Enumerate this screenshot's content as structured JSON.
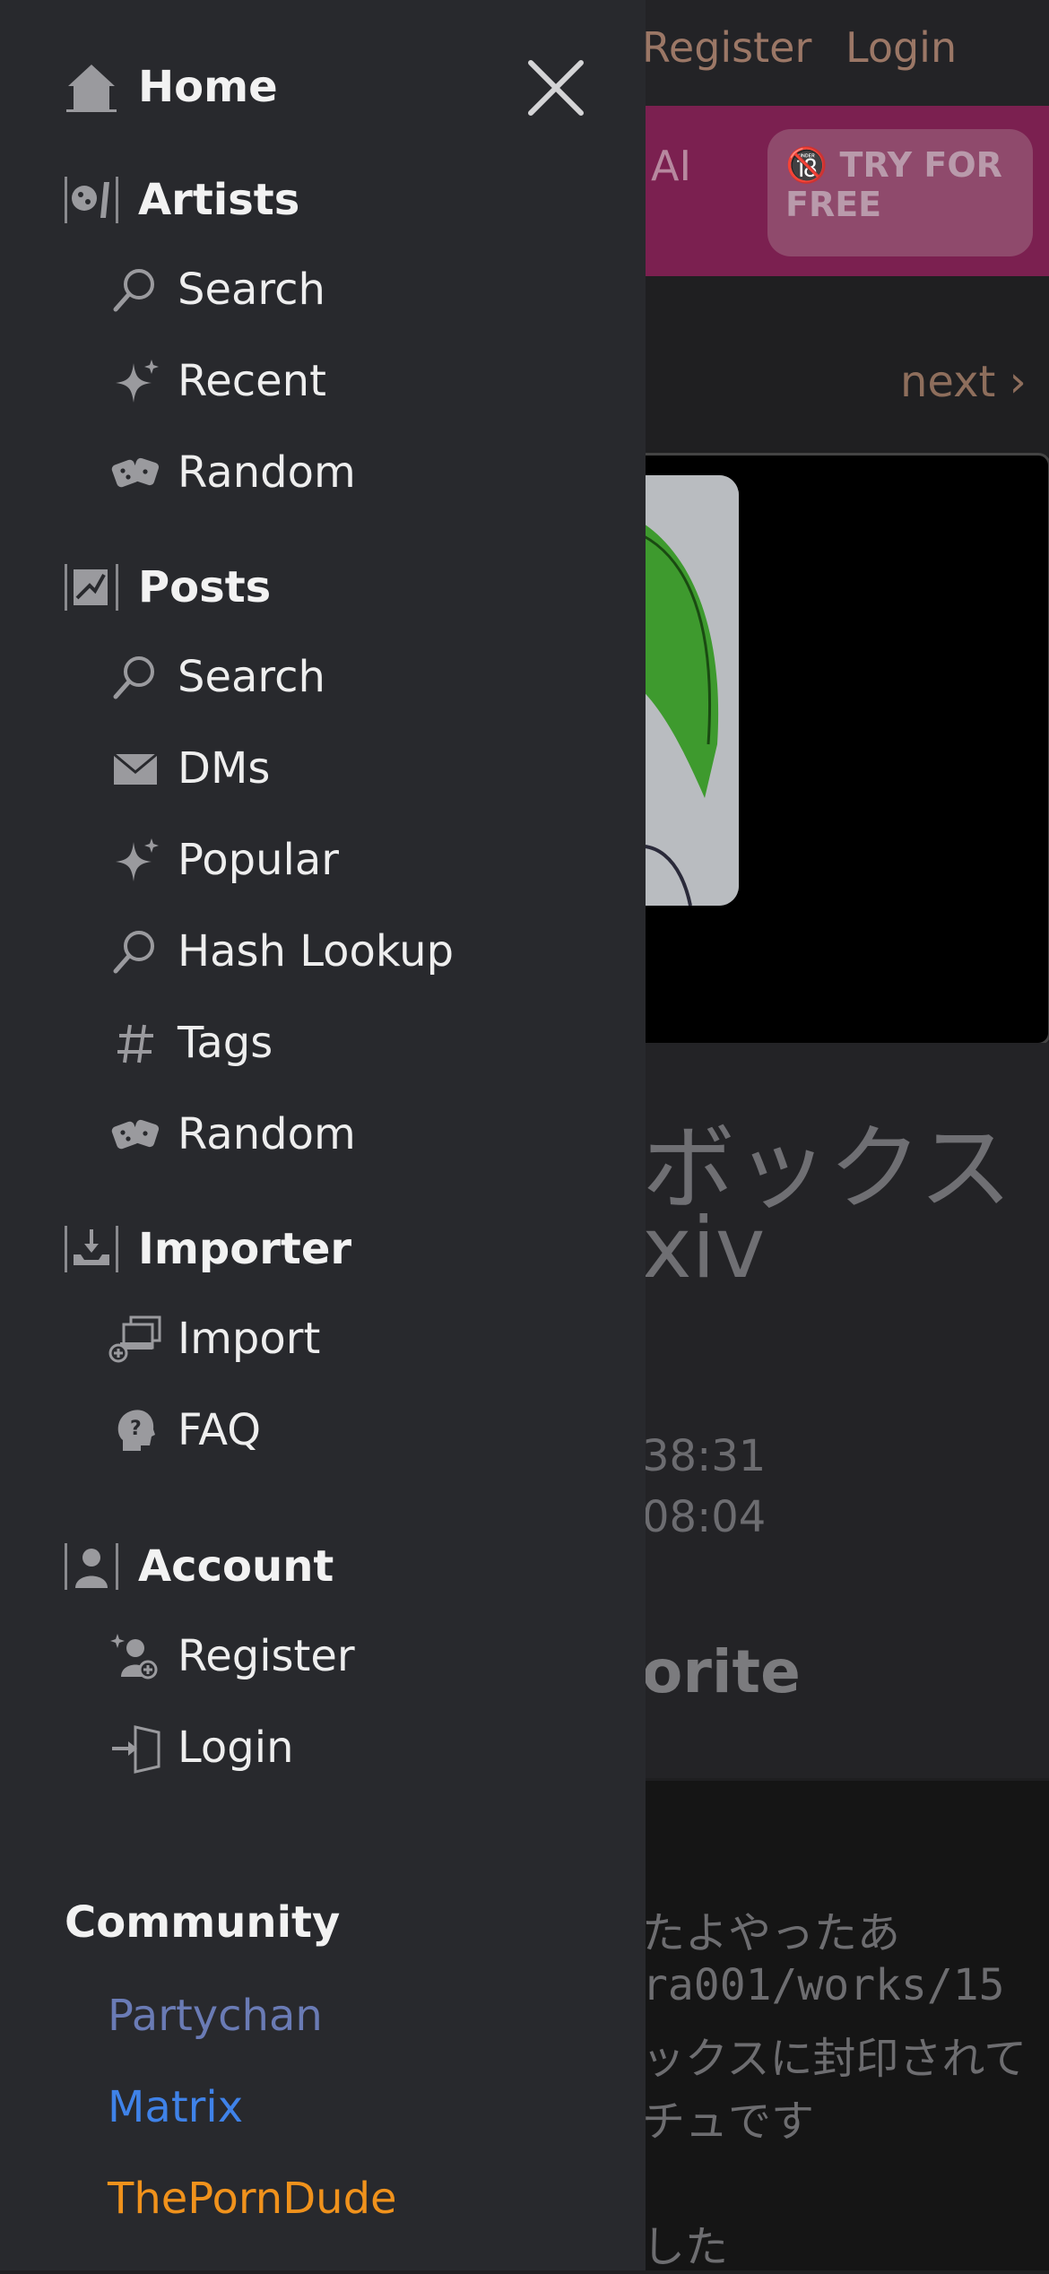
{
  "background": {
    "header": {
      "register": "Register",
      "login": "Login"
    },
    "banner": {
      "ai_label": "AI",
      "try_button": "🔞 TRY FOR FREE"
    },
    "nav": {
      "next": "next ›"
    },
    "post": {
      "title_line1": "ボックス",
      "title_line2": "xiv",
      "time1": "38:31",
      "time2": "08:04",
      "favorite": "orite",
      "content_lines": [
        "たよやったあ",
        "ra001/works/15",
        "ックスに封印されて",
        "チュです",
        "した"
      ]
    }
  },
  "drawer": {
    "close_icon": "close-icon",
    "sections": [
      {
        "label": "Home",
        "icon": "home-icon",
        "items": []
      },
      {
        "label": "Artists",
        "icon": "artist-palette-icon",
        "items": [
          {
            "label": "Search",
            "icon": "search-icon"
          },
          {
            "label": "Recent",
            "icon": "sparkle-icon"
          },
          {
            "label": "Random",
            "icon": "dice-icon"
          }
        ]
      },
      {
        "label": "Posts",
        "icon": "posts-icon",
        "items": [
          {
            "label": "Search",
            "icon": "search-icon"
          },
          {
            "label": "DMs",
            "icon": "envelope-icon"
          },
          {
            "label": "Popular",
            "icon": "sparkle-icon"
          },
          {
            "label": "Hash Lookup",
            "icon": "search-icon"
          },
          {
            "label": "Tags",
            "icon": "hash-icon"
          },
          {
            "label": "Random",
            "icon": "dice-icon"
          }
        ]
      },
      {
        "label": "Importer",
        "icon": "import-tray-icon",
        "items": [
          {
            "label": "Import",
            "icon": "import-add-icon"
          },
          {
            "label": "FAQ",
            "icon": "faq-head-icon"
          }
        ]
      },
      {
        "label": "Account",
        "icon": "account-icon",
        "items": [
          {
            "label": "Register",
            "icon": "register-user-icon"
          },
          {
            "label": "Login",
            "icon": "login-door-icon"
          }
        ]
      }
    ],
    "community": {
      "heading": "Community",
      "links": [
        {
          "label": "Partychan",
          "color": "#6a7bb5"
        },
        {
          "label": "Matrix",
          "color": "#3f82e8"
        },
        {
          "label": "ThePornDude",
          "color": "#f0921c"
        }
      ]
    }
  }
}
